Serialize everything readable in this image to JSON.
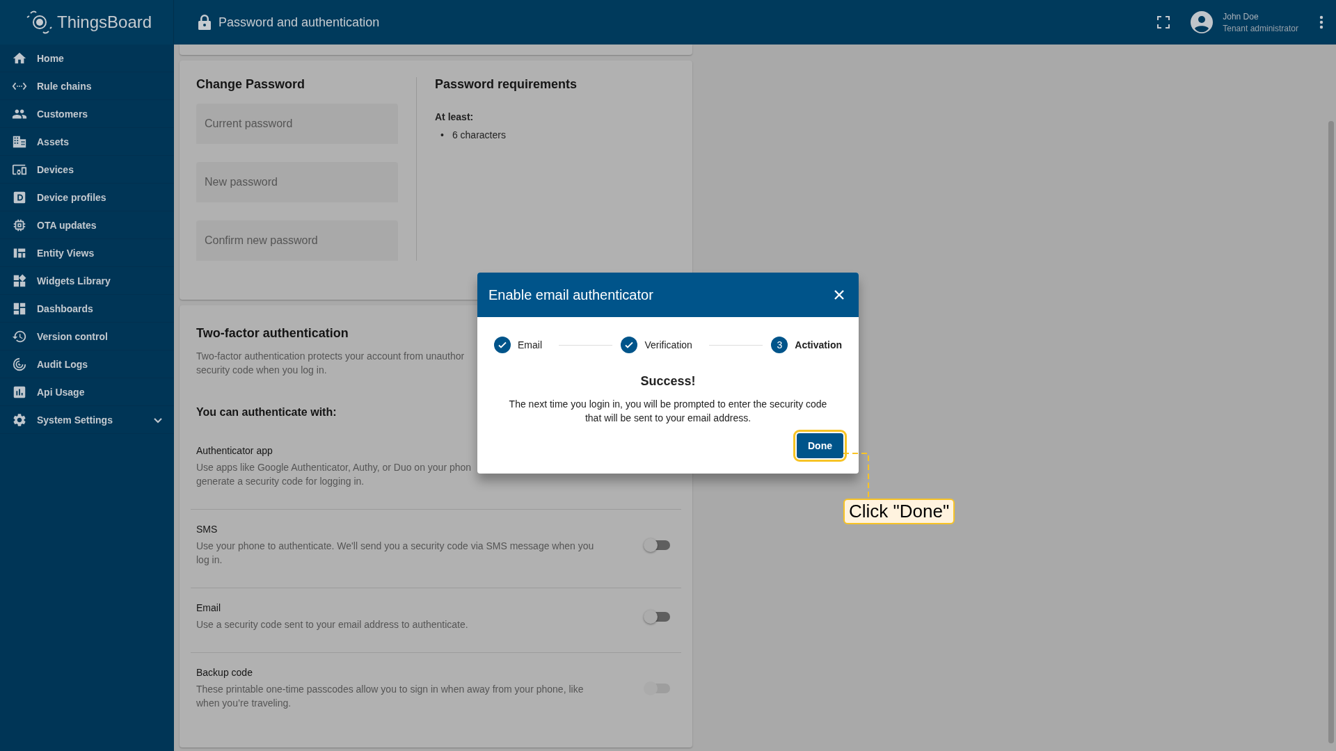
{
  "header": {
    "brand": "ThingsBoard",
    "title": "Password and authentication",
    "user_name": "John Doe",
    "user_role": "Tenant administrator"
  },
  "sidebar": {
    "items": [
      {
        "label": "Home",
        "selected": false
      },
      {
        "label": "Rule chains",
        "selected": false
      },
      {
        "label": "Customers",
        "selected": false
      },
      {
        "label": "Assets",
        "selected": false
      },
      {
        "label": "Devices",
        "selected": false
      },
      {
        "label": "Device profiles",
        "selected": false
      },
      {
        "label": "OTA updates",
        "selected": false
      },
      {
        "label": "Entity Views",
        "selected": false
      },
      {
        "label": "Widgets Library",
        "selected": false
      },
      {
        "label": "Dashboards",
        "selected": false
      },
      {
        "label": "Version control",
        "selected": false
      },
      {
        "label": "Audit Logs",
        "selected": false
      },
      {
        "label": "Api Usage",
        "selected": false
      },
      {
        "label": "System Settings",
        "selected": false,
        "expanded": false
      }
    ]
  },
  "change_password": {
    "title": "Change Password",
    "fields": [
      {
        "placeholder": "Current password"
      },
      {
        "placeholder": "New password"
      },
      {
        "placeholder": "Confirm new password"
      }
    ],
    "requirements_title": "Password requirements",
    "requirements_lead": "At least:",
    "requirements": [
      {
        "bullet": "•",
        "text": "6 characters"
      }
    ]
  },
  "two_factor": {
    "title": "Two-factor authentication",
    "description": "Two-factor authentication protects your account from unauthor\nsecurity code when you log in.",
    "methods_title": "You can authenticate with:",
    "methods": [
      {
        "name": "Authenticator app",
        "description": "Use apps like Google Authenticator, Authy, or Duo on your phon\ngenerate a security code for logging in."
      },
      {
        "name": "SMS",
        "description": "Use your phone to authenticate. We'll send you a security code via SMS message when you log in.",
        "on": false,
        "disabled": false
      },
      {
        "name": "Email",
        "description": "Use a security code sent to your email address to authenticate.",
        "on": false,
        "disabled": false
      },
      {
        "name": "Backup code",
        "description": "These printable one-time passcodes allow you to sign in when away from your phone, like when you’re traveling.",
        "on": false,
        "disabled": true
      }
    ]
  },
  "dialog": {
    "title": "Enable email authenticator",
    "steps": [
      {
        "label": "Email",
        "completed": true,
        "selected": false
      },
      {
        "label": "Verification",
        "completed": true,
        "selected": false
      },
      {
        "label": "Activation",
        "number": "3",
        "completed": false,
        "selected": true
      }
    ],
    "heading": "Success!",
    "message": "The next time you login in, you will be prompted to enter the security code that will be sent to your email address.",
    "button": "Done"
  },
  "annotation": {
    "text": "Click \"Done\""
  }
}
